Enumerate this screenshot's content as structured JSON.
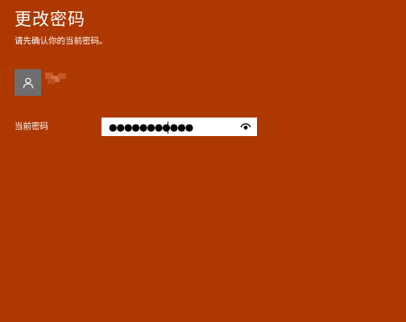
{
  "page": {
    "title": "更改密码",
    "subtitle": "请先确认你的当前密码。"
  },
  "account": {
    "avatar_icon": "person-icon",
    "username": ""
  },
  "form": {
    "current_password_label": "当前密码",
    "current_password_value": "●●●●●●●●●●●",
    "reveal_icon": "eye-icon"
  },
  "colors": {
    "accent_background": "#ad3800",
    "avatar_background": "#6e6e6e",
    "input_background": "#ffffff",
    "text": "#ffffff"
  }
}
